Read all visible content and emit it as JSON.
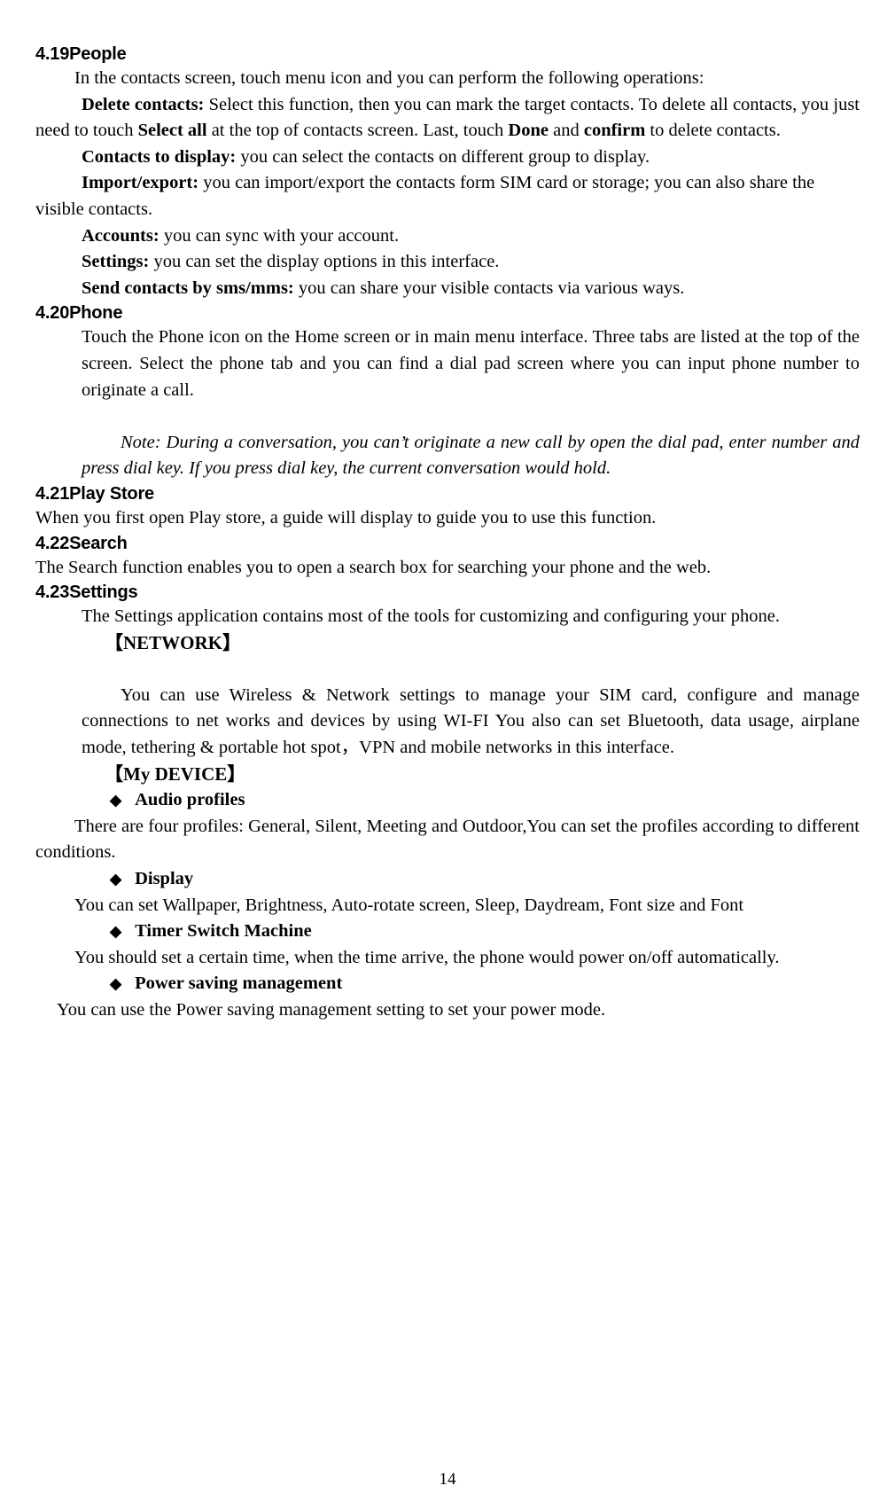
{
  "page": {
    "number": "14"
  },
  "sections": {
    "people": {
      "heading": "4.19People",
      "intro": "In the contacts screen, touch menu icon and you can perform the following operations:",
      "items": {
        "delete_label": "Delete contacts:",
        "delete_text_1": " Select this function, then you can mark the target contacts. To delete all contacts, you just need to touch ",
        "delete_bold_2": "Select all",
        "delete_text_2": " at the top of contacts screen. Last, touch ",
        "delete_bold_3": "Done",
        "delete_text_3": " and ",
        "delete_bold_4": "confirm",
        "delete_text_4": " to delete contacts.",
        "contacts_display_label": "Contacts to display:",
        "contacts_display_text": " you can select the contacts on different group to display.",
        "import_export_label": "Import/export:",
        "import_export_text": " you can import/export the contacts form SIM card or storage; you can also share the visible contacts.",
        "accounts_label": "Accounts:",
        "accounts_text": " you can sync with your account.",
        "settings_label": "Settings:",
        "settings_text": " you can set the display options in this interface.",
        "send_contacts_label": "Send contacts by sms/mms:",
        "send_contacts_text": " you can share your visible contacts via various ways."
      }
    },
    "phone": {
      "heading": "4.20Phone",
      "body": "Touch the Phone icon on the Home screen or in main menu interface. Three tabs are listed at the top of the screen. Select the phone tab and you can find a dial pad screen where you can input phone number to originate a call.",
      "note": "Note: During a conversation, you can’t originate a new call by open the dial pad, enter number and press dial key. If you press dial key, the current conversation would hold."
    },
    "play_store": {
      "heading": "4.21Play Store",
      "body": "When you first open  Play store, a guide will display to guide you to use this function."
    },
    "search": {
      "heading": "4.22Search",
      "body": "The Search function enables you to open a search box for searching your phone and the web."
    },
    "settings": {
      "heading": "4.23Settings",
      "body": "The Settings application contains most of the tools for customizing and configuring your phone.",
      "network_heading": "【NETWORK】",
      "network_body": "You can use Wireless & Network settings to manage your SIM card, configure and manage connections to net works and devices by using WI-FI You also can set Bluetooth, data usage, airplane mode, tethering & portable hot spot，VPN and mobile networks in this interface.",
      "my_device_heading": "【My DEVICE】",
      "bullets": [
        {
          "glyph": "◆",
          "title": "Audio profiles",
          "body": "There are four profiles: General, Silent, Meeting and Outdoor,You can set the profiles according to different conditions."
        },
        {
          "glyph": "◆",
          "title": "Display",
          "body": "You can set Wallpaper, Brightness, Auto-rotate screen, Sleep, Daydream, Font size and Font"
        },
        {
          "glyph": "◆",
          "title": "Timer Switch Machine",
          "body": "You should set a certain time, when the time arrive, the phone would power on/off automatically."
        },
        {
          "glyph": "◆",
          "title": "Power saving management",
          "body": "You can use the Power saving management setting to set your power mode."
        }
      ]
    }
  }
}
